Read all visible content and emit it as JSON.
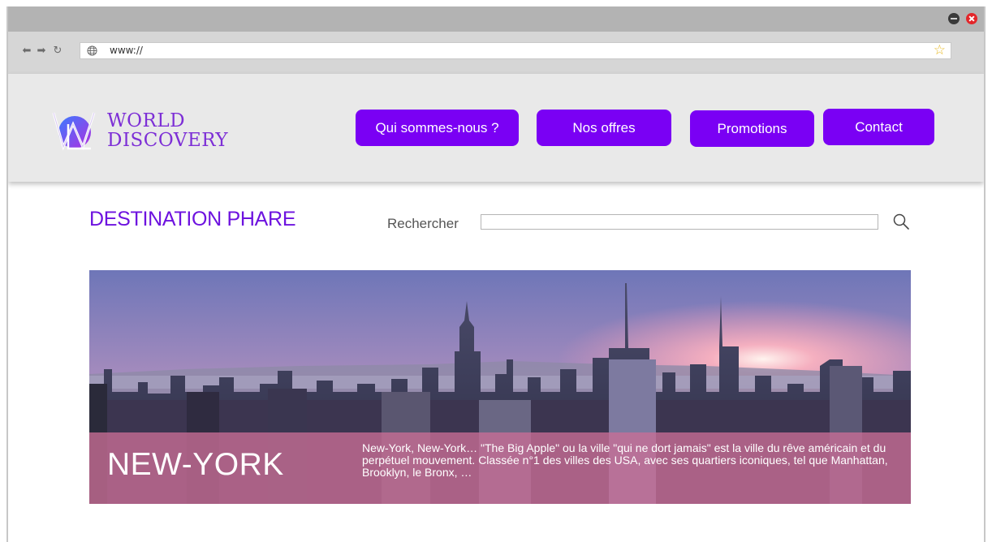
{
  "browser": {
    "url": "www://",
    "icons": {
      "back": "arrow-left-icon",
      "forward": "arrow-right-icon",
      "reload": "reload-icon",
      "site": "globe-icon",
      "bookmark": "star-icon",
      "minimize": "minimize-icon",
      "close": "close-icon"
    }
  },
  "header": {
    "logo": {
      "line1": "WORLD",
      "line2": "DISCOVERY",
      "color": "#7d2fd6"
    },
    "menu": [
      {
        "label": "Qui sommes-nous ?"
      },
      {
        "label": "Nos offres"
      },
      {
        "label": "Promotions"
      },
      {
        "label": "Contact"
      }
    ],
    "menu_color": "#7a00f4"
  },
  "main": {
    "section_title": "DESTINATION PHARE",
    "search": {
      "label": "Rechercher",
      "value": ""
    },
    "featured": {
      "city": "NEW-YORK",
      "description": "New-York, New-York… \"The Big Apple\" ou la ville \"qui ne dort jamais\" est la ville du rêve américain et du perpétuel mouvement. Classée n°1 des villes des USA, avec ses quartiers iconiques, tel que Manhattan, Brooklyn, le Bronx, …"
    }
  }
}
